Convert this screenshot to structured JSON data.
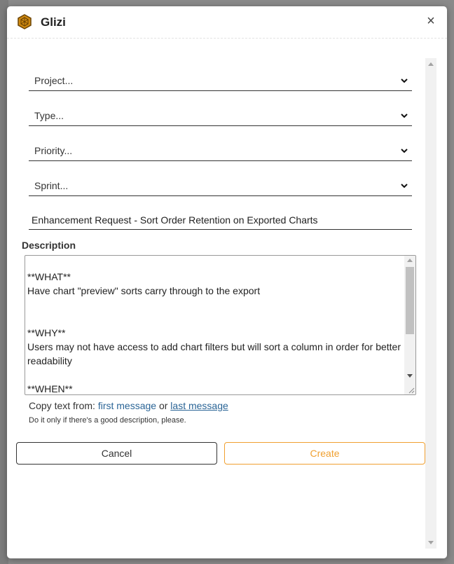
{
  "dialog": {
    "app_title": "Glizi",
    "close_label": "×"
  },
  "form": {
    "project_select": "Project...",
    "type_select": "Type...",
    "priority_select": "Priority...",
    "sprint_select": "Sprint...",
    "title_value": "Enhancement Request - Sort Order Retention on Exported Charts",
    "description_label": "Description",
    "description_value": "\n**WHAT**\nHave chart \"preview\" sorts carry through to the export\n\n\n**WHY**\nUsers may not have access to add chart filters but will sort a column in order for better readability\n\n**WHEN**",
    "copy_prefix": "Copy text from:",
    "copy_first": "first message",
    "copy_or": "or",
    "copy_last": "last message",
    "hint": "Do it only if there's a good description, please."
  },
  "actions": {
    "cancel_label": "Cancel",
    "create_label": "Create"
  },
  "colors": {
    "accent": "#f0a030",
    "link": "#2a6496",
    "logo": "#d08a10"
  },
  "icons": {
    "logo": "hexagon-logo-icon",
    "close": "close-icon",
    "select_arrow": "chevron-down-icon"
  }
}
